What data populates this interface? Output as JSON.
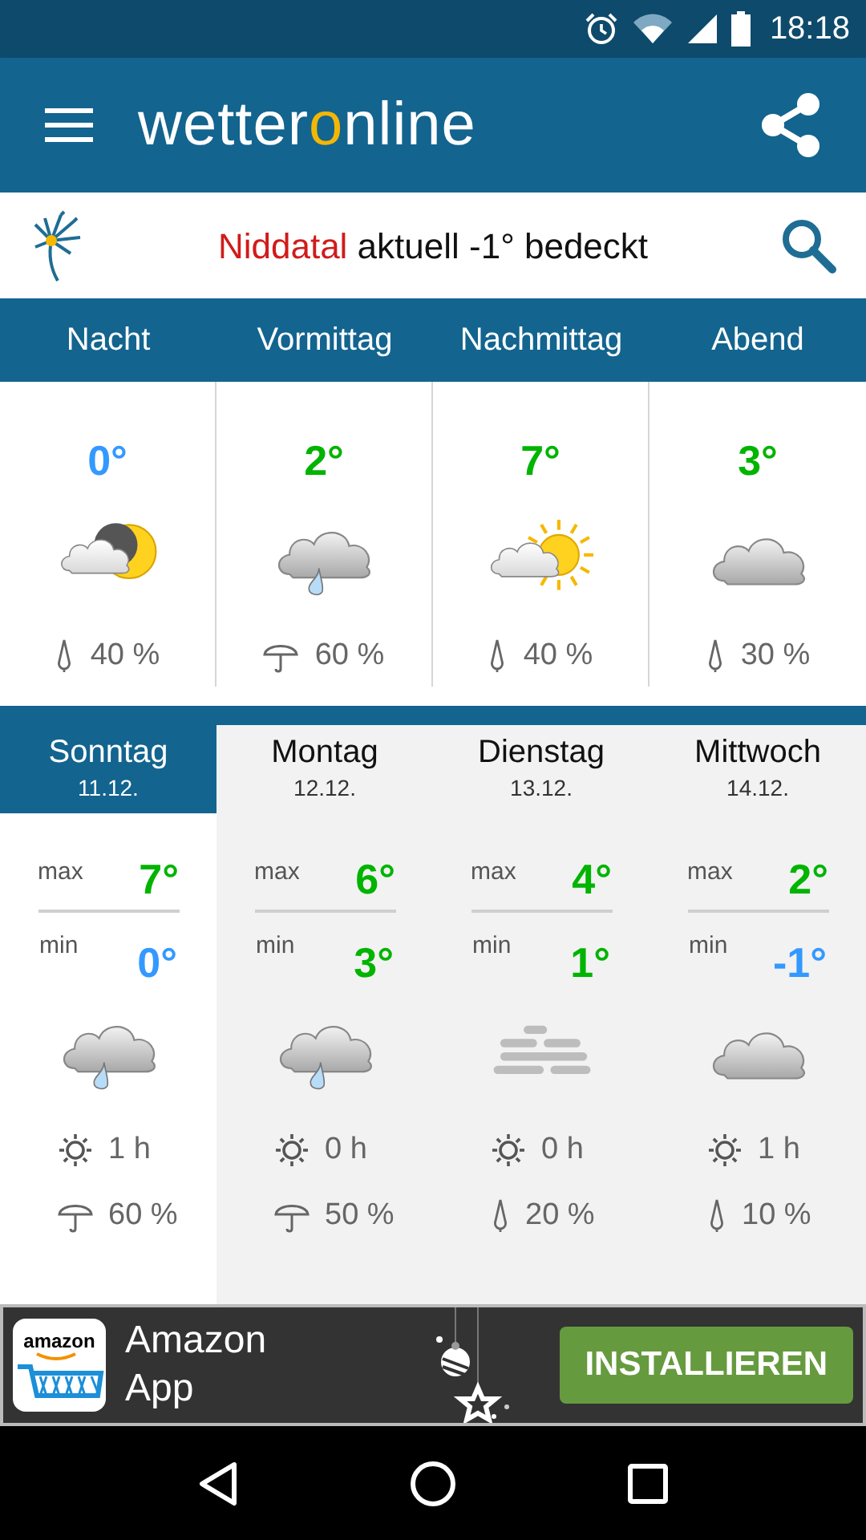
{
  "status_bar": {
    "time": "18:18"
  },
  "app_bar": {
    "logo": "wetteronline"
  },
  "location": {
    "place": "Niddatal",
    "summary": "aktuell -1° bedeckt"
  },
  "periods": [
    {
      "label": "Nacht",
      "temp": "0°",
      "color": "#3399ff",
      "sky": {
        "kind": "moon_cloud"
      },
      "precip": {
        "kind": "drop",
        "text": "40 %"
      }
    },
    {
      "label": "Vormittag",
      "temp": "2°",
      "color": "#00b400",
      "sky": {
        "kind": "rain"
      },
      "precip": {
        "kind": "umbrella",
        "text": "60 %"
      }
    },
    {
      "label": "Nachmittag",
      "temp": "7°",
      "color": "#00b400",
      "sky": {
        "kind": "sun_cloud"
      },
      "precip": {
        "kind": "drop",
        "text": "40 %"
      }
    },
    {
      "label": "Abend",
      "temp": "3°",
      "color": "#00b400",
      "sky": {
        "kind": "cloud"
      },
      "precip": {
        "kind": "drop",
        "text": "30 %"
      }
    }
  ],
  "days": [
    {
      "day": "Sonntag",
      "date": "11.12.",
      "selected": true,
      "max_label": "max",
      "max": {
        "text": "7°",
        "color": "#00b400"
      },
      "min_label": "min",
      "min": {
        "text": "0°",
        "color": "#3399ff"
      },
      "sky": {
        "kind": "rain"
      },
      "sun": "1 h",
      "precip": {
        "kind": "umbrella",
        "text": "60 %"
      }
    },
    {
      "day": "Montag",
      "date": "12.12.",
      "selected": false,
      "max_label": "max",
      "max": {
        "text": "6°",
        "color": "#00b400"
      },
      "min_label": "min",
      "min": {
        "text": "3°",
        "color": "#00b400"
      },
      "sky": {
        "kind": "rain"
      },
      "sun": "0 h",
      "precip": {
        "kind": "umbrella",
        "text": "50 %"
      }
    },
    {
      "day": "Dienstag",
      "date": "13.12.",
      "selected": false,
      "max_label": "max",
      "max": {
        "text": "4°",
        "color": "#00b400"
      },
      "min_label": "min",
      "min": {
        "text": "1°",
        "color": "#00b400"
      },
      "sky": {
        "kind": "fog"
      },
      "sun": "0 h",
      "precip": {
        "kind": "drop",
        "text": "20 %"
      }
    },
    {
      "day": "Mittwoch",
      "date": "14.12.",
      "selected": false,
      "max_label": "max",
      "max": {
        "text": "2°",
        "color": "#00b400"
      },
      "min_label": "min",
      "min": {
        "text": "-1°",
        "color": "#3399ff"
      },
      "sky": {
        "kind": "cloud"
      },
      "sun": "1 h",
      "precip": {
        "kind": "drop",
        "text": "10 %"
      }
    }
  ],
  "ad": {
    "icon_text": "amazon",
    "title": "Amazon\nApp",
    "button": "INSTALLIEREN"
  }
}
